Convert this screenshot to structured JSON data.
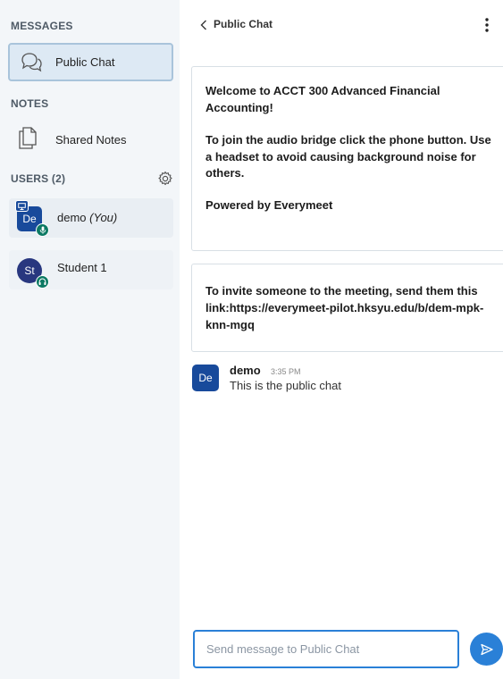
{
  "sidebar": {
    "messages_title": "MESSAGES",
    "public_chat_label": "Public Chat",
    "notes_title": "NOTES",
    "shared_notes_label": "Shared Notes",
    "users_title": "USERS (2)",
    "users": [
      {
        "initials": "De",
        "name": "demo",
        "suffix": "(You)",
        "presenter": true,
        "status": "microphone"
      },
      {
        "initials": "St",
        "name": "Student 1",
        "suffix": "",
        "presenter": false,
        "status": "listen-only"
      }
    ]
  },
  "chat": {
    "title": "Public Chat",
    "welcome": {
      "line1_pre": "Welcome to ",
      "line1_bold": "ACCT 300 Advanced Financial Accounting!",
      "line2": "To join the audio bridge click the phone button. Use a headset to avoid causing background noise for others.",
      "line3": "Powered by Everymeet"
    },
    "invite": "To invite someone to the meeting, send them this link:https://everymeet-pilot.hksyu.edu/b/dem-mpk-knn-mgq",
    "messages": [
      {
        "initials": "De",
        "author": "demo",
        "time": "3:35 PM",
        "text": "This is the public chat"
      }
    ],
    "compose_placeholder": "Send message to Public Chat"
  },
  "colors": {
    "accent": "#2a80d7",
    "avatar_presenter": "#184a9b",
    "avatar_student": "#28377f",
    "status_green": "#0d7a64",
    "sidebar_bg": "#f3f6f9",
    "selected_bg": "#dde9f4"
  },
  "icons": {
    "public_chat": "chat-bubbles-icon",
    "shared_notes": "document-icon",
    "users_settings": "gear-icon",
    "back": "chevron-left-icon",
    "more": "kebab-menu-icon",
    "send": "send-icon"
  }
}
